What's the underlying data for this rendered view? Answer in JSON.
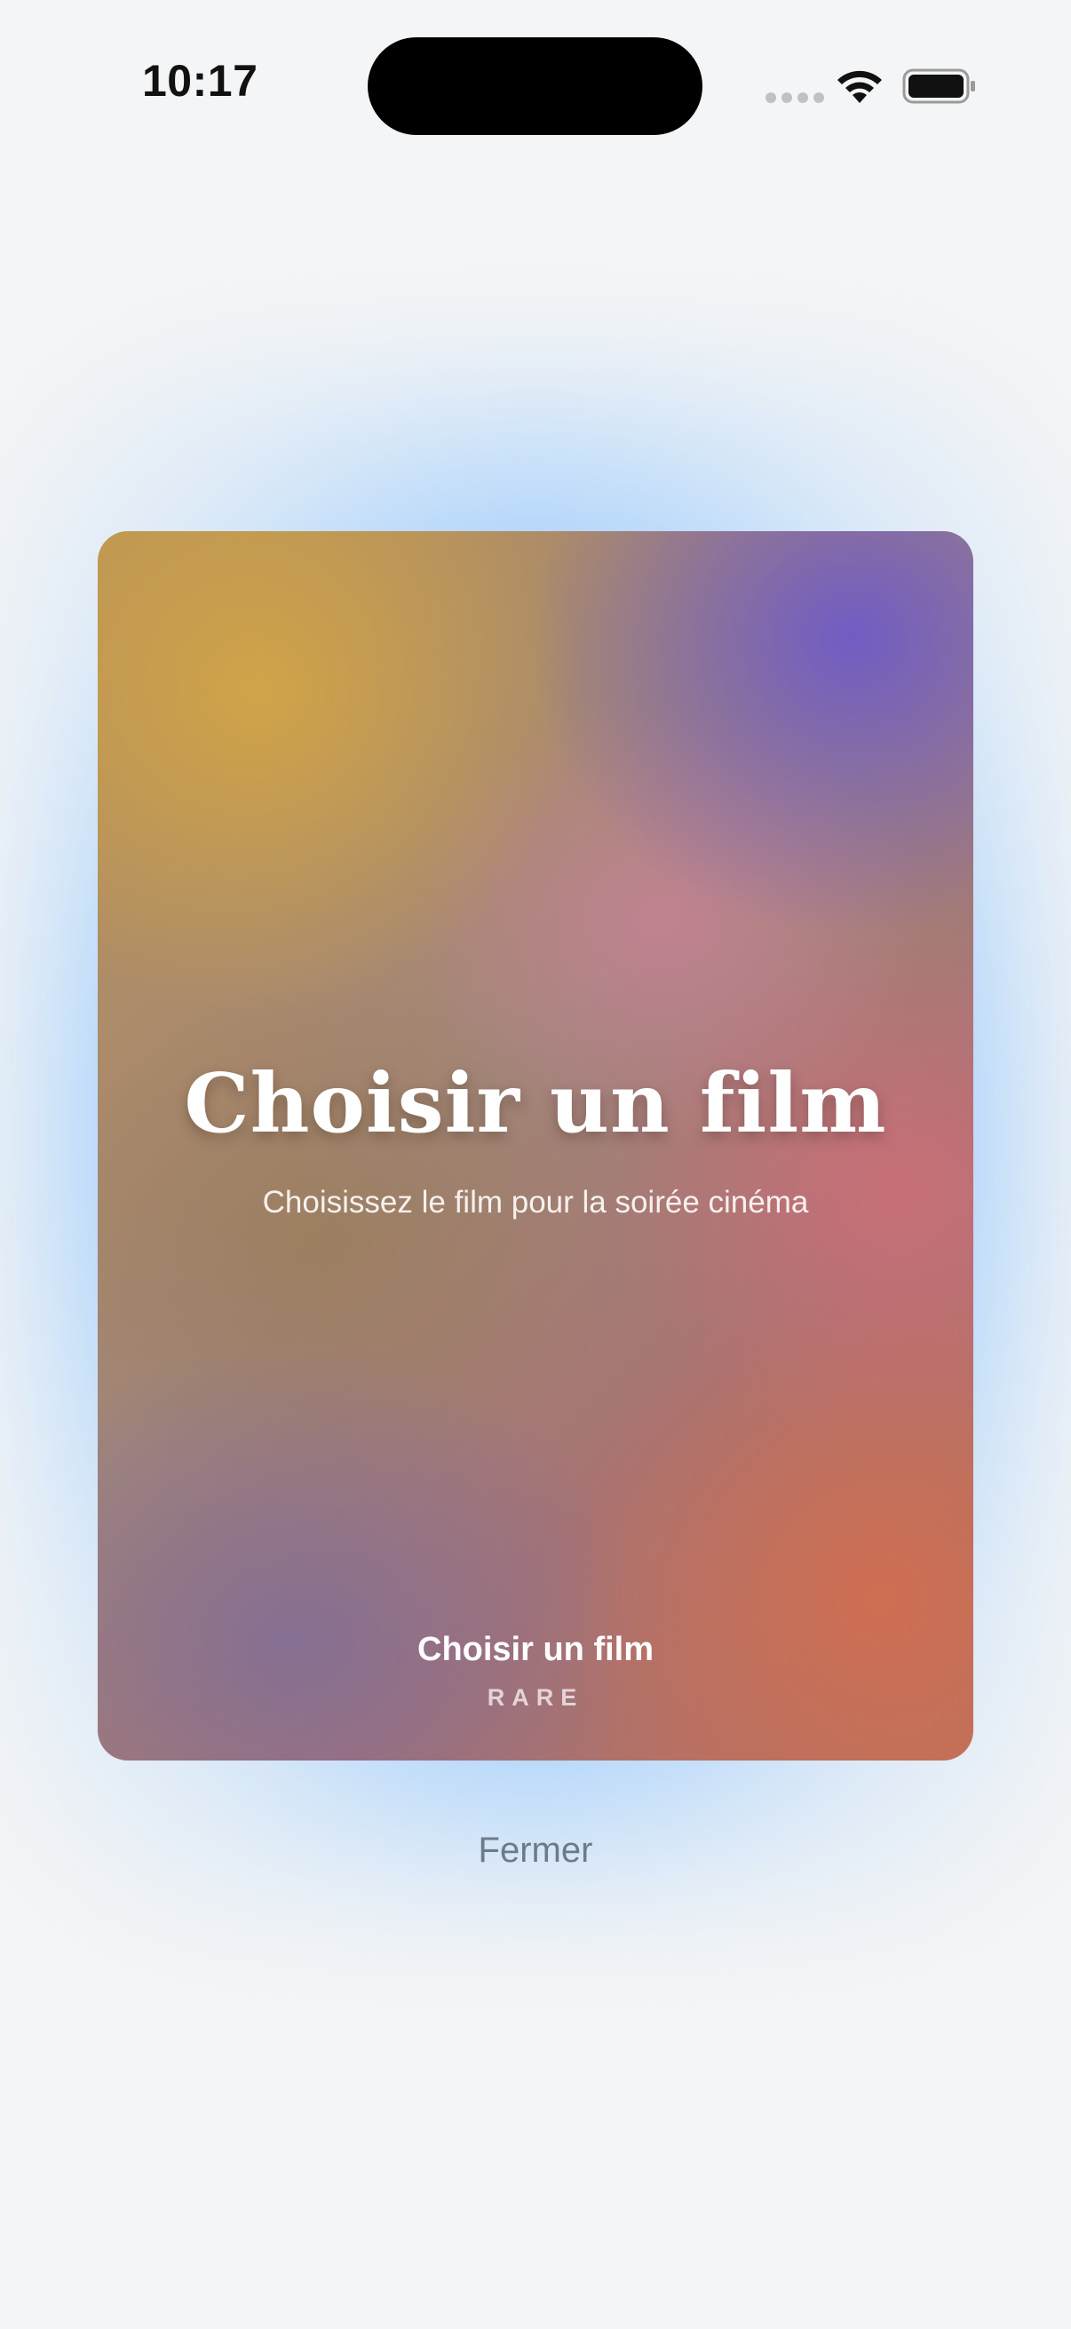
{
  "status_bar": {
    "time": "10:17",
    "icons": [
      "cellular-signal-icon",
      "wifi-icon",
      "battery-icon"
    ]
  },
  "card": {
    "title": "Choisir un film",
    "subtitle": "Choisissez le film pour la soirée cinéma",
    "footer_title": "Choisir un film",
    "rarity": "RARE"
  },
  "actions": {
    "close_label": "Fermer"
  },
  "colors": {
    "background": "#f4f5f6",
    "glow": "#50a5ff",
    "close_text": "#6e7a8a"
  }
}
